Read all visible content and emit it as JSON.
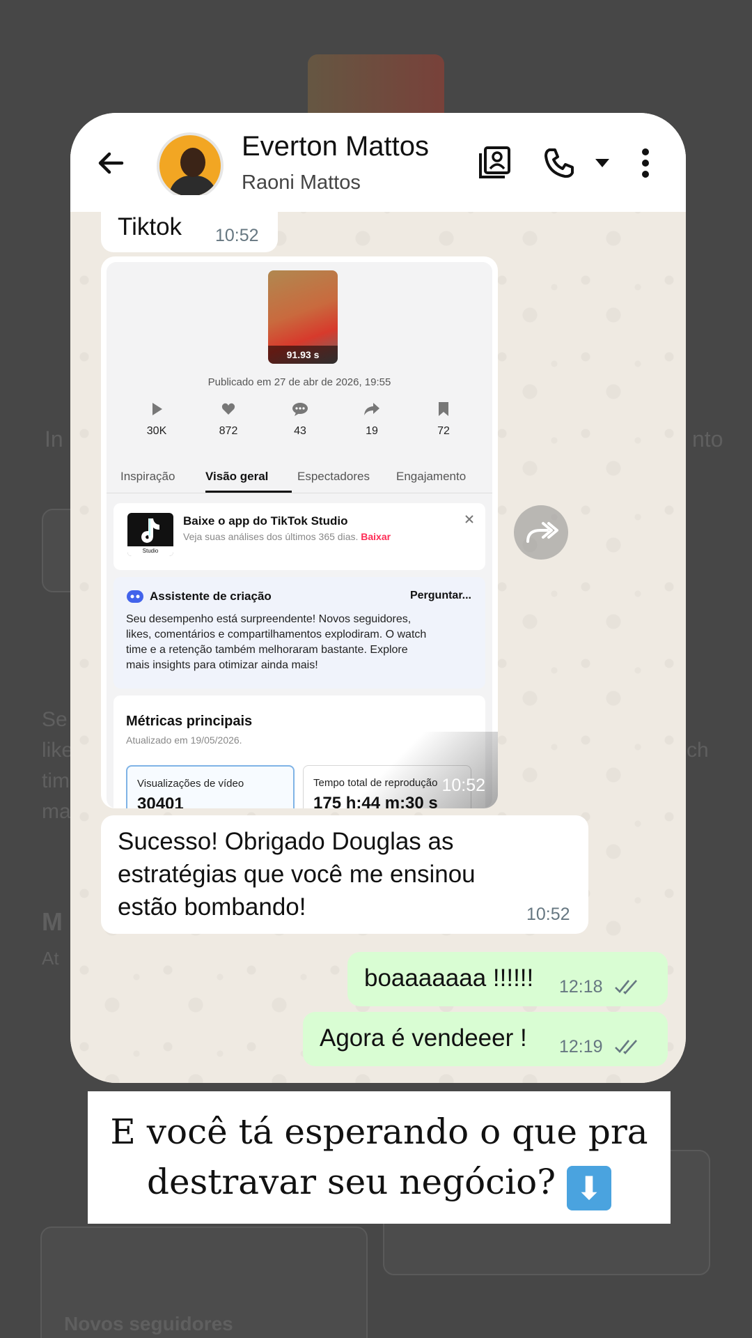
{
  "background": {
    "left_fragments": [
      "In",
      "Se",
      "like",
      "tim",
      "ma",
      "M",
      "At"
    ],
    "right_fragments": [
      "nto",
      "ch"
    ],
    "bottom_label": "Novos seguidores"
  },
  "header": {
    "contact_name": "Everton Mattos",
    "contact_subtitle": "Raoni Mattos"
  },
  "messages": {
    "tiktok": {
      "text": "Tiktok",
      "time": "10:52"
    },
    "image_time": "10:52",
    "success": {
      "line1": "Sucesso! Obrigado Douglas as",
      "line2": "estratégias que você me ensinou",
      "line3": "estão bombando!",
      "time": "10:52"
    },
    "out1": {
      "text": "boaaaaaaa !!!!!!",
      "time": "12:18"
    },
    "out2": {
      "text": "Agora é vendeeer !",
      "time": "12:19"
    }
  },
  "tiktok_screenshot": {
    "thumb_duration": "91.93 s",
    "published": "Publicado em 27 de abr de 2026, 19:55",
    "stats": [
      {
        "icon": "play-icon",
        "value": "30K"
      },
      {
        "icon": "heart-icon",
        "value": "872"
      },
      {
        "icon": "comment-icon",
        "value": "43"
      },
      {
        "icon": "share-icon",
        "value": "19"
      },
      {
        "icon": "bookmark-icon",
        "value": "72"
      }
    ],
    "tabs": [
      "Inspiração",
      "Visão geral",
      "Espectadores",
      "Engajamento"
    ],
    "banner": {
      "title": "Baixe o app do TikTok Studio",
      "subtitle": "Veja suas análises dos últimos 365 dias.",
      "link": "Baixar",
      "logo_label": "Studio"
    },
    "assistant": {
      "title": "Assistente de criação",
      "action": "Perguntar...",
      "line1": "Seu desempenho está surpreendente! Novos seguidores,",
      "line2": "likes, comentários e compartilhamentos explodiram. O watch",
      "line3": "time e a retenção também melhoraram bastante. Explore",
      "line4": "mais insights para otimizar ainda mais!"
    },
    "metrics": {
      "title": "Métricas principais",
      "updated": "Atualizado em 19/05/2026.",
      "box1_label": "Visualizações de vídeo",
      "box1_value": "30401",
      "box2_label": "Tempo total de reprodução",
      "box2_value": "175 h:44 m:30 s"
    }
  },
  "caption": {
    "line1": "E você tá esperando o que pra",
    "line2": "destravar seu negócio?",
    "emoji": "⬇"
  },
  "colors": {
    "outgoing_bubble": "#d9fdd3",
    "incoming_bubble": "#ffffff",
    "chat_background": "#efeae2",
    "read_ticks": "#53bdeb",
    "tiktok_accent": "#fe2c55"
  }
}
